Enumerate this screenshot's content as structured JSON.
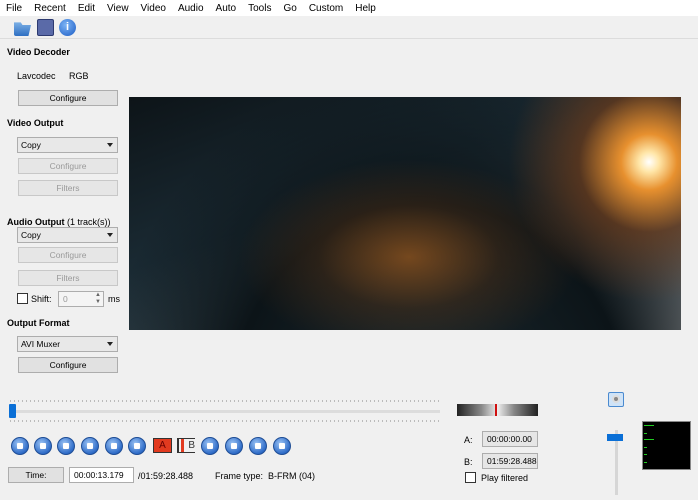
{
  "menu": [
    "File",
    "Recent",
    "Edit",
    "View",
    "Video",
    "Audio",
    "Auto",
    "Tools",
    "Go",
    "Custom",
    "Help"
  ],
  "toolbar": {
    "open": "open-icon",
    "save": "save-icon",
    "info": "info-icon"
  },
  "video_decoder": {
    "title": "Video Decoder",
    "codec": "Lavcodec",
    "format": "RGB",
    "configure": "Configure"
  },
  "video_output": {
    "title": "Video Output",
    "codec": "Copy",
    "configure": "Configure",
    "filters": "Filters"
  },
  "audio_output": {
    "title": "Audio Output",
    "tracks": "(1 track(s))",
    "codec": "Copy",
    "configure": "Configure",
    "filters": "Filters",
    "shift_label": "Shift:",
    "shift_value": "0",
    "shift_unit": "ms"
  },
  "output_format": {
    "title": "Output Format",
    "muxer": "AVI Muxer",
    "configure": "Configure"
  },
  "timeline": {
    "position_fraction": 0.0019
  },
  "markers": {
    "a": "A",
    "b": "B"
  },
  "status": {
    "time_button": "Time:",
    "current_time": "00:00:13.179",
    "total_time": "/01:59:28.488",
    "frame_type": "Frame type:  B-FRM (04)"
  },
  "selection": {
    "a_label": "A:",
    "a_value": "00:00:00.00",
    "b_label": "B:",
    "b_value": "01:59:28.488",
    "play_filtered": "Play filtered"
  },
  "volume": {
    "level": 0.9
  }
}
